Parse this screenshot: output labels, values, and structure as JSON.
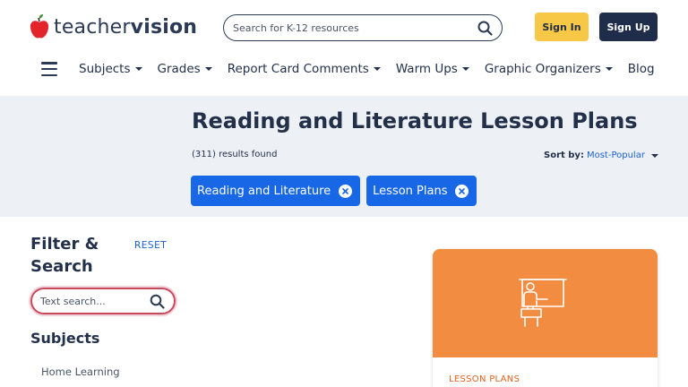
{
  "brand": {
    "logo_text_regular": "teacher",
    "logo_text_bold": "vision",
    "accent_color": "#e3242b"
  },
  "header": {
    "search_placeholder": "Search for K-12 resources",
    "sign_in_label": "Sign In",
    "sign_up_label": "Sign Up",
    "sign_in_color": "#f7c845",
    "sign_up_color": "#1f2d4a"
  },
  "nav": {
    "menu_icon": "hamburger-icon",
    "items": [
      {
        "label": "Subjects",
        "dropdown": true
      },
      {
        "label": "Grades",
        "dropdown": true
      },
      {
        "label": "Report Card Comments",
        "dropdown": true
      },
      {
        "label": "Warm Ups",
        "dropdown": true
      },
      {
        "label": "Graphic Organizers",
        "dropdown": true
      },
      {
        "label": "Blog",
        "dropdown": false
      }
    ]
  },
  "banner": {
    "title": "Reading and Literature Lesson Plans",
    "results": "(311) results found",
    "sort_label": "Sort by:",
    "sort_value": "Most-Popular",
    "chips": [
      {
        "label": "Reading and Literature"
      },
      {
        "label": "Lesson Plans"
      }
    ],
    "chip_color": "#1767e6"
  },
  "sidebar": {
    "filter_title": "Filter & Search",
    "reset_label": "RESET",
    "text_search_placeholder": "Text search...",
    "subjects_title": "Subjects",
    "subject_items": [
      "Home Learning"
    ]
  },
  "card": {
    "type_label": "LESSON PLANS",
    "image_color": "#f28c40",
    "icon": "teacher-at-board-icon"
  }
}
